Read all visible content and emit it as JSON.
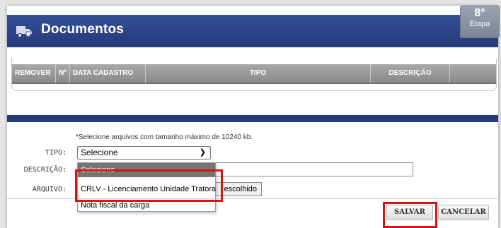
{
  "header": {
    "title": "Documentos",
    "icon": "truck-document-icon",
    "stage_number": "8°",
    "stage_label": "Etapa"
  },
  "table": {
    "columns": [
      "REMOVER",
      "Nº",
      "DATA CADASTRO",
      "TIPO",
      "DESCRIÇÃO",
      ""
    ]
  },
  "form": {
    "note": "*Selecione arquivos com tamanho máximo de 10240 kb.",
    "tipo_label": "TIPO:",
    "tipo_value": "Selecione",
    "descricao_label": "DESCRIÇÃO:",
    "arquivo_label": "ARQUIVO:",
    "file_text": "escolhido"
  },
  "dropdown": {
    "options": [
      "Selecione",
      "CRLV - Licenciamento Unidade Tratora",
      "Nota fiscal da carga"
    ],
    "selected_index": 0
  },
  "actions": {
    "save_label": "SALVAR",
    "cancel_label": "CANCELAR"
  },
  "colors": {
    "header_blue": "#25397c",
    "highlight_red": "#e01010"
  }
}
